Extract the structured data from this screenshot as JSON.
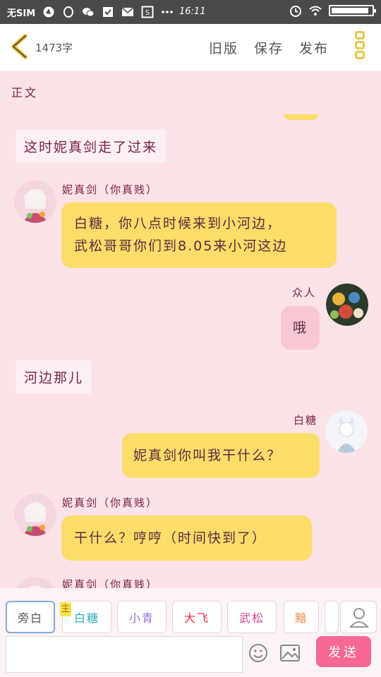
{
  "status_bar": {
    "carrier": "无SIM",
    "time": "16:11",
    "icons": [
      "browser-icon",
      "qq-icon",
      "wechat-icon",
      "task-icon",
      "mail-icon",
      "screenshot-icon",
      "more-dots-icon",
      "alarm-icon",
      "wifi-icon",
      "battery-icon"
    ]
  },
  "app_bar": {
    "word_count": "1473字",
    "old_version": "旧版",
    "save": "保存",
    "publish": "发布"
  },
  "section_label": "正文",
  "messages": {
    "narration_1": "这时妮真剑走了过来",
    "m1_name": "妮真剑（你真贱）",
    "m1_line1": "白糖，你八点时候来到小河边，",
    "m1_line2": "武松哥哥你们到8.05来小河这边",
    "m2_name": "众人",
    "m2_text": "哦",
    "narration_2": "河边那儿",
    "m3_name": "白糖",
    "m3_text": "妮真剑你叫我干什么？",
    "m4_name": "妮真剑（你真贱）",
    "m4_text": "干什么？哼哼（时间快到了）",
    "m5_name": "妮真剑（你真贱）"
  },
  "roles": {
    "narrator": "旁白",
    "main_tag": "主",
    "baitang": "白糖",
    "xiaoqing": "小青",
    "dafei": "大飞",
    "wusong": "武松",
    "partial": "黯"
  },
  "input": {
    "placeholder": "",
    "send": "发送"
  },
  "colors": {
    "background": "#fbe3e8",
    "bubble_yellow": "#fcdd6a",
    "bubble_pink": "#f7c8d4",
    "send_button": "#f56994",
    "name_text": "#7a2046"
  }
}
